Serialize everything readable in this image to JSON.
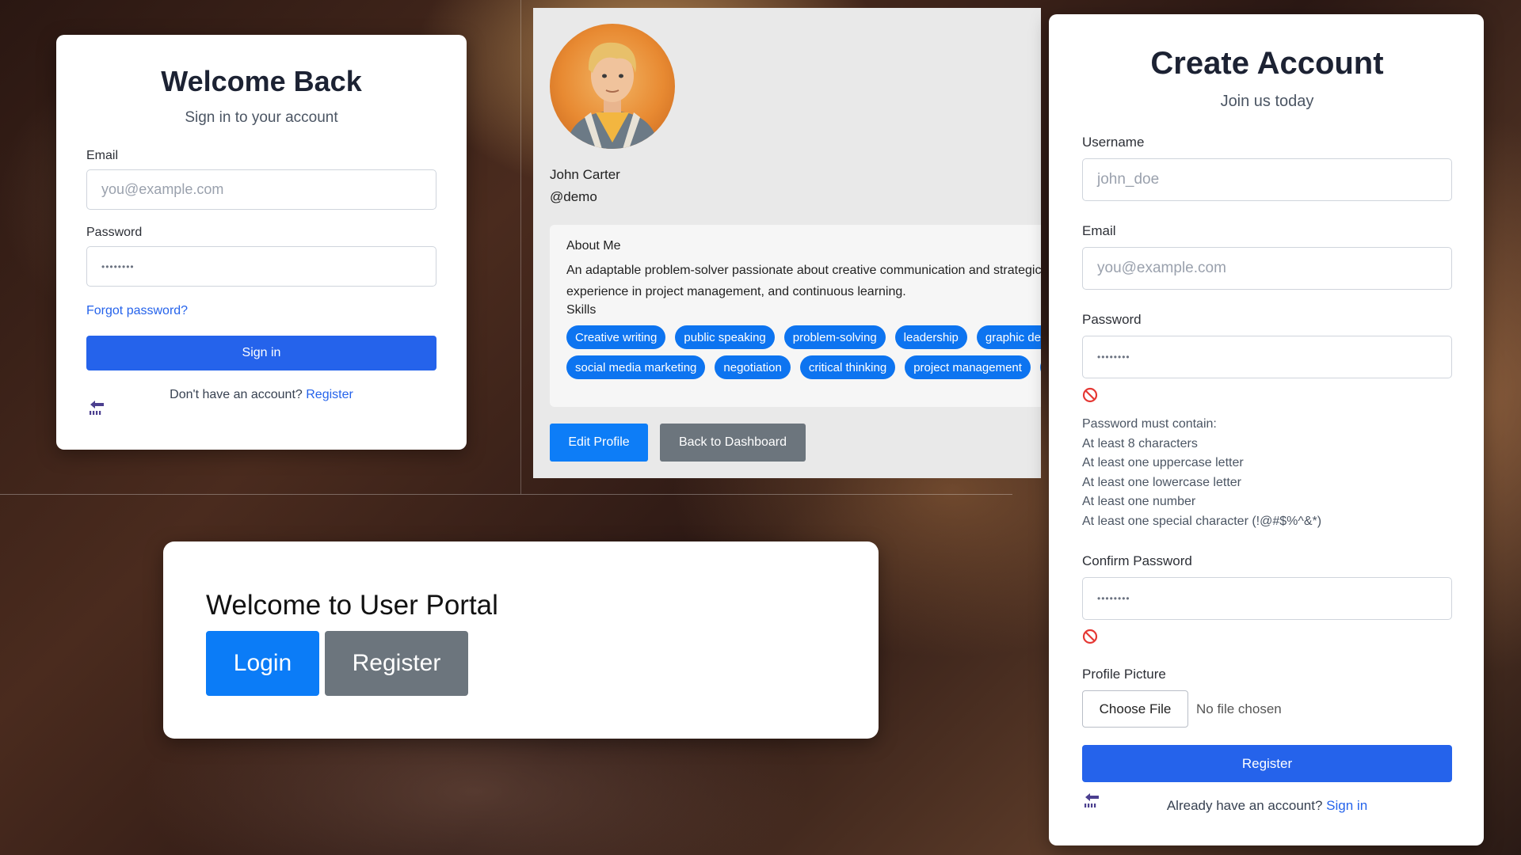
{
  "login": {
    "title": "Welcome Back",
    "subtitle": "Sign in to your account",
    "email_label": "Email",
    "email_placeholder": "you@example.com",
    "password_label": "Password",
    "password_value": "••••••••",
    "forgot_link": "Forgot password?",
    "signin_button": "Sign in",
    "footer_text": "Don't have an account?",
    "footer_link": "Register",
    "back_icon": "back-arrow-icon"
  },
  "profile": {
    "name": "John Carter",
    "handle": "@demo",
    "about_heading": "About Me",
    "about_text": "An adaptable problem-solver passionate about creative communication and strategic thinking, with experience in project management, and continuous learning.",
    "skills_heading": "Skills",
    "skills_row1": [
      "Creative writing",
      "public speaking",
      "problem-solving",
      "leadership",
      "graphic design"
    ],
    "skills_row2": [
      "social media marketing",
      "negotiation",
      "critical thinking",
      "project management",
      ""
    ],
    "edit_button": "Edit Profile",
    "back_button": "Back to Dashboard",
    "chip_color": "#0d74f0"
  },
  "portal": {
    "title": "Welcome to User Portal",
    "login_button": "Login",
    "register_button": "Register"
  },
  "register": {
    "title": "Create Account",
    "subtitle": "Join us today",
    "username_label": "Username",
    "username_placeholder": "john_doe",
    "email_label": "Email",
    "email_placeholder": "you@example.com",
    "password_label": "Password",
    "password_value": "••••••••",
    "rules_heading": "Password must contain:",
    "rules": [
      "At least 8 characters",
      "At least one uppercase letter",
      "At least one lowercase letter",
      "At least one number",
      "At least one special character (!@#$%^&*)"
    ],
    "confirm_label": "Confirm Password",
    "confirm_value": "••••••••",
    "picture_label": "Profile Picture",
    "choose_file": "Choose File",
    "file_status": "No file chosen",
    "register_button": "Register",
    "footer_text": "Already have an account?",
    "footer_link": "Sign in",
    "invalid_icon": "prohibited-icon"
  },
  "colors": {
    "primary_blue": "#2563eb",
    "bootstrap_blue": "#0d7df7",
    "secondary_gray": "#6c757d",
    "error_red": "#e53935"
  }
}
